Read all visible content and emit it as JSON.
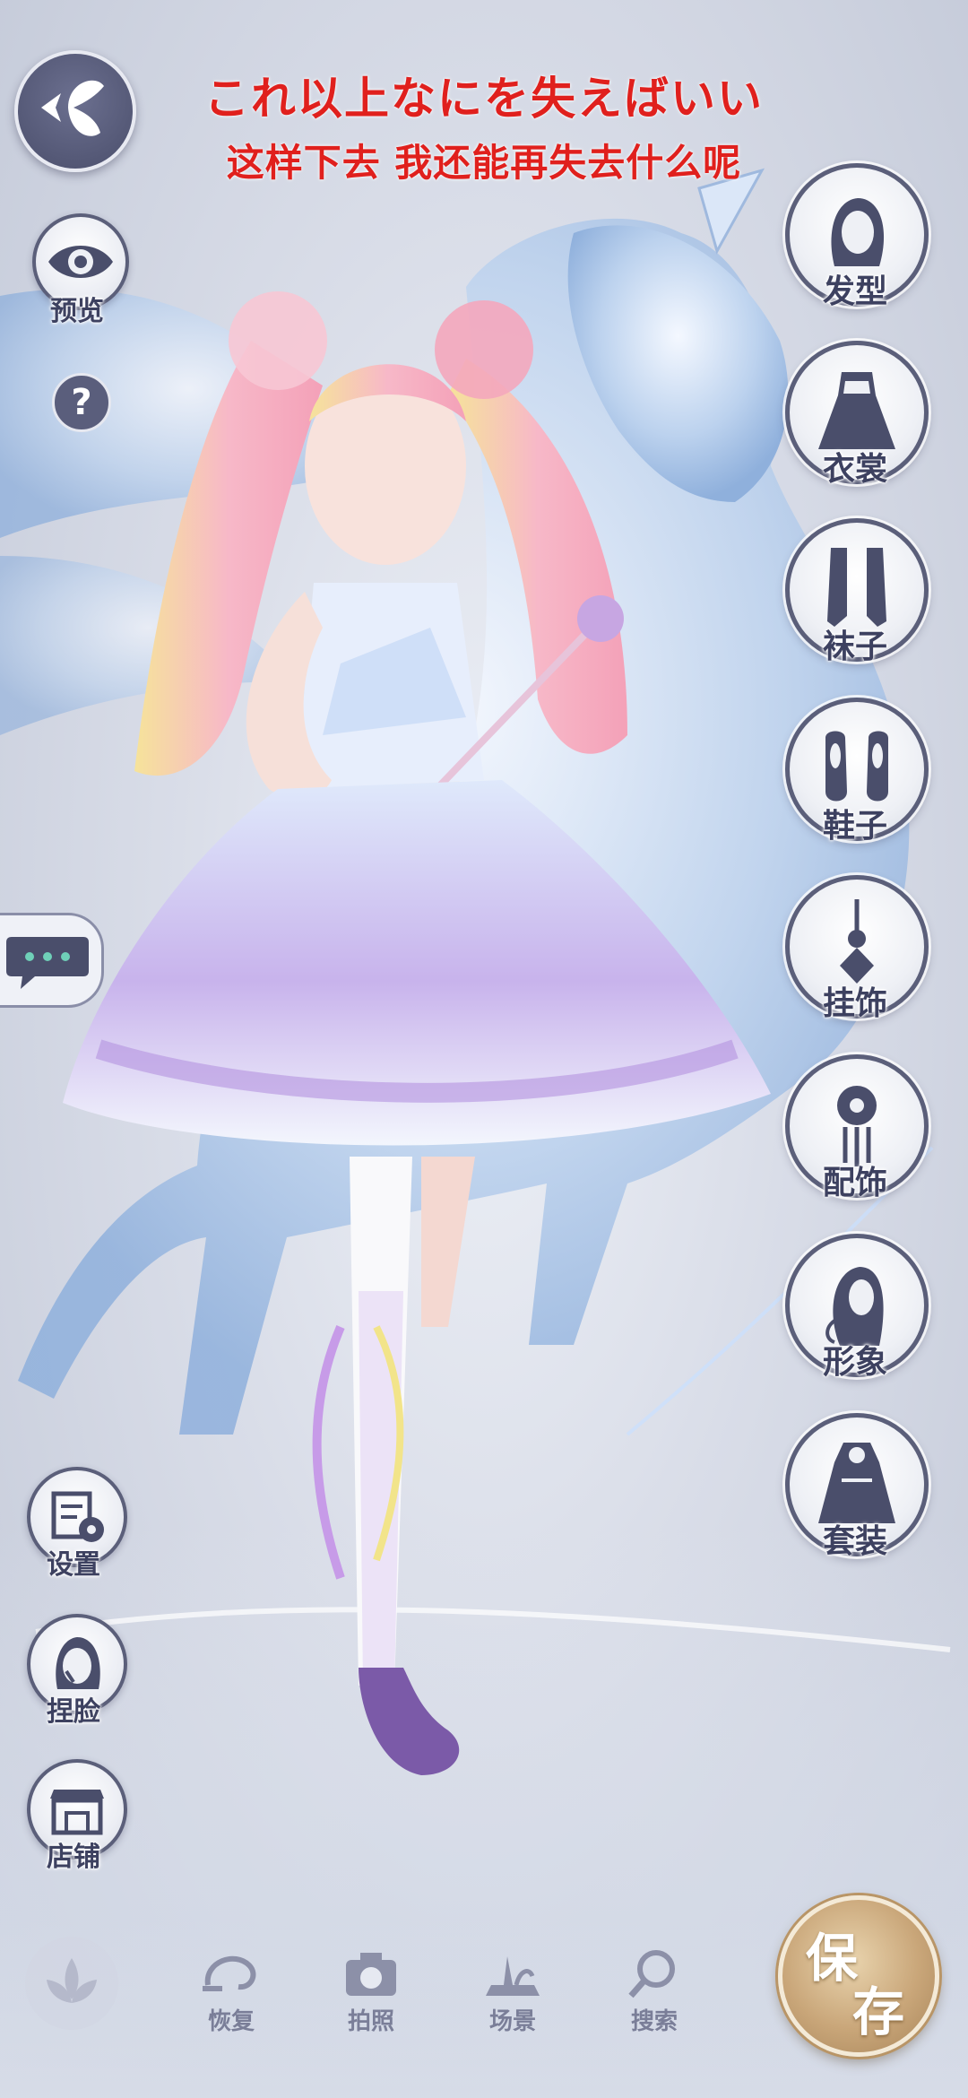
{
  "lyrics": {
    "japanese": "これ以上なにを失えばいい",
    "chinese": "这样下去 我还能再失去什么呢"
  },
  "left_menu": {
    "preview_label": "预览",
    "help_symbol": "?",
    "settings_label": "设置",
    "face_label": "捏脸",
    "shop_label": "店铺"
  },
  "right_menu": [
    {
      "label": "发型",
      "icon": "hair-icon"
    },
    {
      "label": "衣裳",
      "icon": "dress-icon"
    },
    {
      "label": "袜子",
      "icon": "socks-icon"
    },
    {
      "label": "鞋子",
      "icon": "shoes-icon"
    },
    {
      "label": "挂饰",
      "icon": "pendant-icon"
    },
    {
      "label": "配饰",
      "icon": "hairpin-icon"
    },
    {
      "label": "形象",
      "icon": "portrait-icon"
    },
    {
      "label": "套装",
      "icon": "outfit-icon"
    }
  ],
  "bottom_bar": {
    "restore_label": "恢复",
    "photo_label": "拍照",
    "scene_label": "场景",
    "search_label": "搜索",
    "save_top": "保",
    "save_bottom": "存"
  },
  "colors": {
    "lyric": "#e0201d",
    "icon_dark": "#4a4e6b",
    "save_gold": "#c9a679"
  }
}
